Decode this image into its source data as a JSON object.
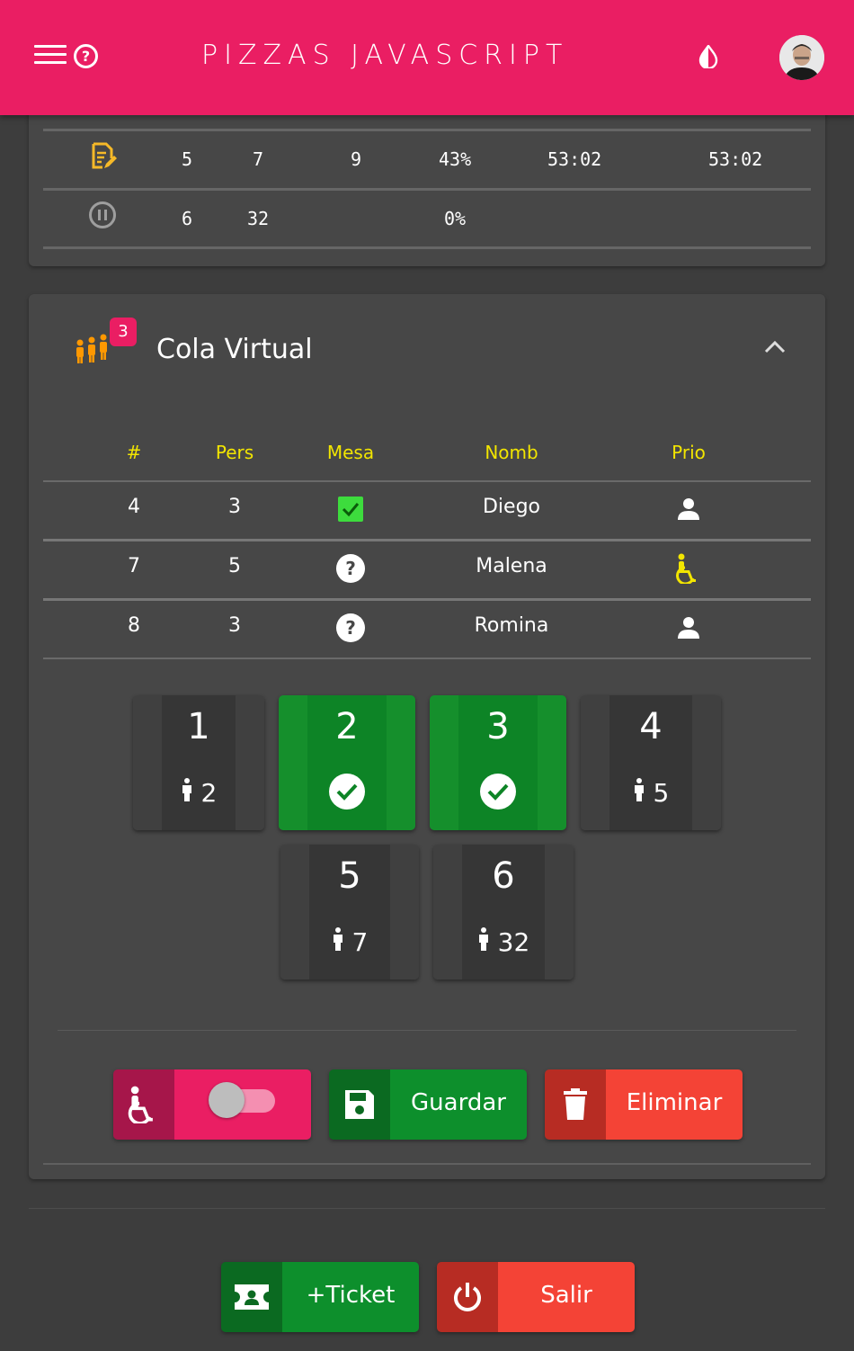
{
  "header": {
    "title": "PIZZAS JAVASCRIPT",
    "accent_color": "#ea1e63",
    "icons": [
      "menu-icon",
      "help-icon",
      "theme-contrast-icon",
      "user-avatar"
    ]
  },
  "stats": {
    "rows": [
      {
        "icon": "edit-document-icon",
        "c1": "5",
        "c2": "7",
        "c3": "9",
        "pct": "43%",
        "t1": "53:02",
        "t2": "53:02"
      },
      {
        "icon": "pause-circle-icon",
        "c1": "6",
        "c2": "32",
        "c3": "",
        "pct": "0%",
        "t1": "",
        "t2": ""
      }
    ]
  },
  "cola": {
    "title": "Cola Virtual",
    "badge": "3",
    "headers": [
      "#",
      "Pers",
      "Mesa",
      "Nomb",
      "Prio"
    ],
    "rows": [
      {
        "num": "4",
        "pers": "3",
        "mesa": "checked",
        "nombre": "Diego",
        "prio": "person-icon"
      },
      {
        "num": "7",
        "pers": "5",
        "mesa": "unknown",
        "nombre": "Malena",
        "prio": "wheelchair-icon"
      },
      {
        "num": "8",
        "pers": "3",
        "mesa": "unknown",
        "nombre": "Romina",
        "prio": "person-icon"
      }
    ],
    "tables": [
      {
        "num": "1",
        "people": "2",
        "status": "free"
      },
      {
        "num": "2",
        "people": "",
        "status": "selected"
      },
      {
        "num": "3",
        "people": "",
        "status": "selected"
      },
      {
        "num": "4",
        "people": "5",
        "status": "free"
      },
      {
        "num": "5",
        "people": "7",
        "status": "free"
      },
      {
        "num": "6",
        "people": "32",
        "status": "free"
      }
    ],
    "priority_toggle": false,
    "save_label": "Guardar",
    "delete_label": "Eliminar"
  },
  "footer": {
    "ticket_label": "+Ticket",
    "exit_label": "Salir"
  },
  "colors": {
    "green": "#0d8426",
    "red": "#f44336",
    "yellow": "#f2e500",
    "orange": "#ff9800"
  }
}
